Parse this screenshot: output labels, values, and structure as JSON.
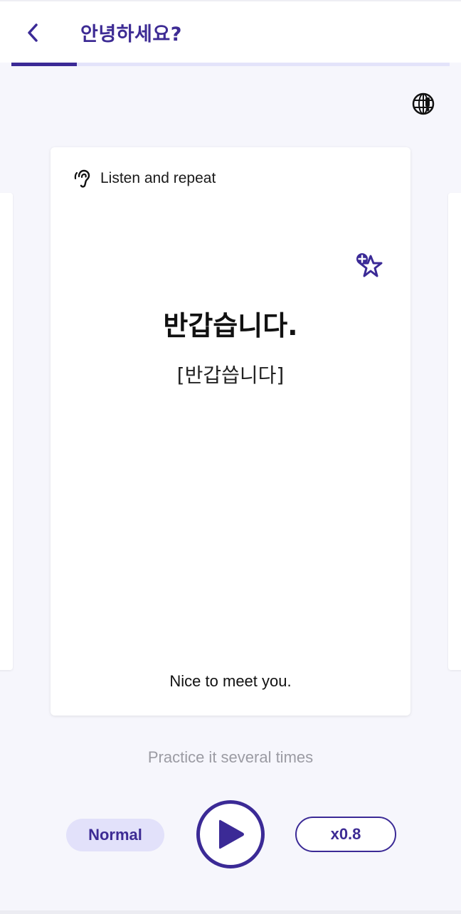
{
  "header": {
    "title": "안녕하세요?",
    "back_icon": "chevron-left-icon"
  },
  "progress": {
    "fraction": 0.15
  },
  "toolbar": {
    "translate_icon": "globe-translate-icon"
  },
  "card": {
    "mode_icon": "ear-icon",
    "mode_label": "Listen and repeat",
    "bookmark_icon": "star-add-icon",
    "phrase": "반갑습니다.",
    "pronunciation": "[반갑씁니다]",
    "translation": "Nice to meet you."
  },
  "hint": "Practice it several times",
  "controls": {
    "normal_label": "Normal",
    "play_icon": "play-icon",
    "slow_label": "x0.8"
  },
  "colors": {
    "accent": "#3b2a96",
    "accent_light": "#e2e1fa",
    "background": "#f6f6fc"
  }
}
